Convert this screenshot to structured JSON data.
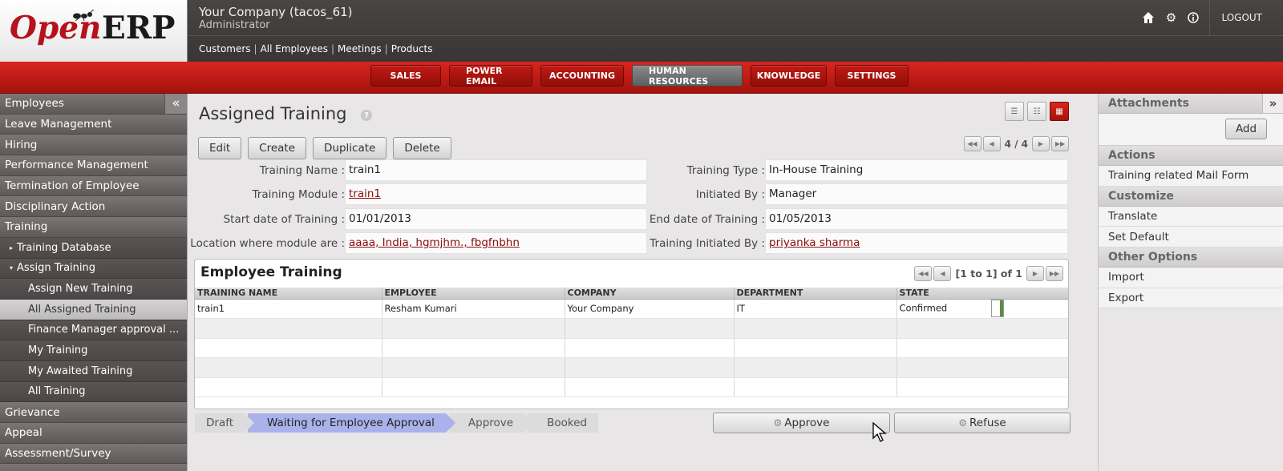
{
  "header": {
    "logo_open": "Open",
    "logo_erp": "ERP",
    "company": "Your Company (tacos_61)",
    "user_role": "Administrator",
    "shortcuts": [
      "Customers",
      "All Employees",
      "Meetings",
      "Products"
    ],
    "logout_label": "LOGOUT"
  },
  "menubar": {
    "items": [
      "SALES",
      "POWER EMAIL",
      "ACCOUNTING",
      "HUMAN RESOURCES",
      "KNOWLEDGE",
      "SETTINGS"
    ],
    "active": "HUMAN RESOURCES"
  },
  "sidebar": {
    "collapse_icon": "«",
    "items": [
      {
        "label": "Employees",
        "kind": "category"
      },
      {
        "label": "Leave Management",
        "kind": "category"
      },
      {
        "label": "Hiring",
        "kind": "category"
      },
      {
        "label": "Performance Management",
        "kind": "category"
      },
      {
        "label": "Termination of Employee",
        "kind": "category"
      },
      {
        "label": "Disciplinary Action",
        "kind": "category"
      },
      {
        "label": "Training",
        "kind": "category"
      },
      {
        "label": "Training Database",
        "kind": "submenu",
        "arrow": "▸"
      },
      {
        "label": "Assign Training",
        "kind": "submenu",
        "arrow": "▾"
      },
      {
        "label": "Assign New Training",
        "kind": "leaf"
      },
      {
        "label": "All Assigned Training",
        "kind": "leaf",
        "selected": true
      },
      {
        "label": "Finance Manager approval ...",
        "kind": "leaf"
      },
      {
        "label": "My Training",
        "kind": "leaf"
      },
      {
        "label": "My Awaited Training",
        "kind": "leaf"
      },
      {
        "label": "All Training",
        "kind": "leaf"
      },
      {
        "label": "Grievance",
        "kind": "category"
      },
      {
        "label": "Appeal",
        "kind": "category"
      },
      {
        "label": "Assessment/Survey",
        "kind": "category"
      }
    ]
  },
  "main": {
    "title": "Assigned Training",
    "help": "?",
    "actions": {
      "edit": "Edit",
      "create": "Create",
      "duplicate": "Duplicate",
      "delete": "Delete"
    },
    "pager": "4 / 4",
    "form": {
      "training_name_label": "Training Name :",
      "training_name": "train1",
      "training_module_label": "Training Module :",
      "training_module": "train1",
      "start_date_label": "Start date of Training :",
      "start_date": "01/01/2013",
      "location_label": "Location where module are :",
      "location": "aaaa, India, hgmjhm., fbgfnbhn",
      "training_type_label": "Training Type :",
      "training_type": "In-House Training",
      "initiated_by_label": "Initiated By :",
      "initiated_by": "Manager",
      "end_date_label": "End date of Training :",
      "end_date": "01/05/2013",
      "training_initiated_by_label": "Training Initiated By :",
      "training_initiated_by": "priyanka sharma"
    },
    "employee_training": {
      "title": "Employee Training",
      "pager": "[1 to 1] of 1",
      "columns": [
        "TRAINING NAME",
        "EMPLOYEE",
        "COMPANY",
        "DEPARTMENT",
        "STATE"
      ],
      "rows": [
        [
          "train1",
          "Resham Kumari",
          "Your Company",
          "IT",
          "Confirmed"
        ]
      ]
    },
    "workflow": {
      "steps": [
        "Draft",
        "Waiting for Employee Approval",
        "Approve",
        "Booked"
      ],
      "current": "Waiting for Employee Approval"
    },
    "buttons": {
      "approve": "Approve",
      "refuse": "Refuse"
    }
  },
  "rightbar": {
    "attachments": "Attachments",
    "expand_icon": "»",
    "add": "Add",
    "actions_header": "Actions",
    "actions": [
      "Training related Mail Form"
    ],
    "customize_header": "Customize",
    "customize": [
      "Translate",
      "Set Default"
    ],
    "other_header": "Other Options",
    "other": [
      "Import",
      "Export"
    ]
  },
  "colors": {
    "brand_red": "#b5121b",
    "menubar_red": "#c41a14",
    "workflow_current": "#aab2ec",
    "link": "#8b0c0c"
  }
}
